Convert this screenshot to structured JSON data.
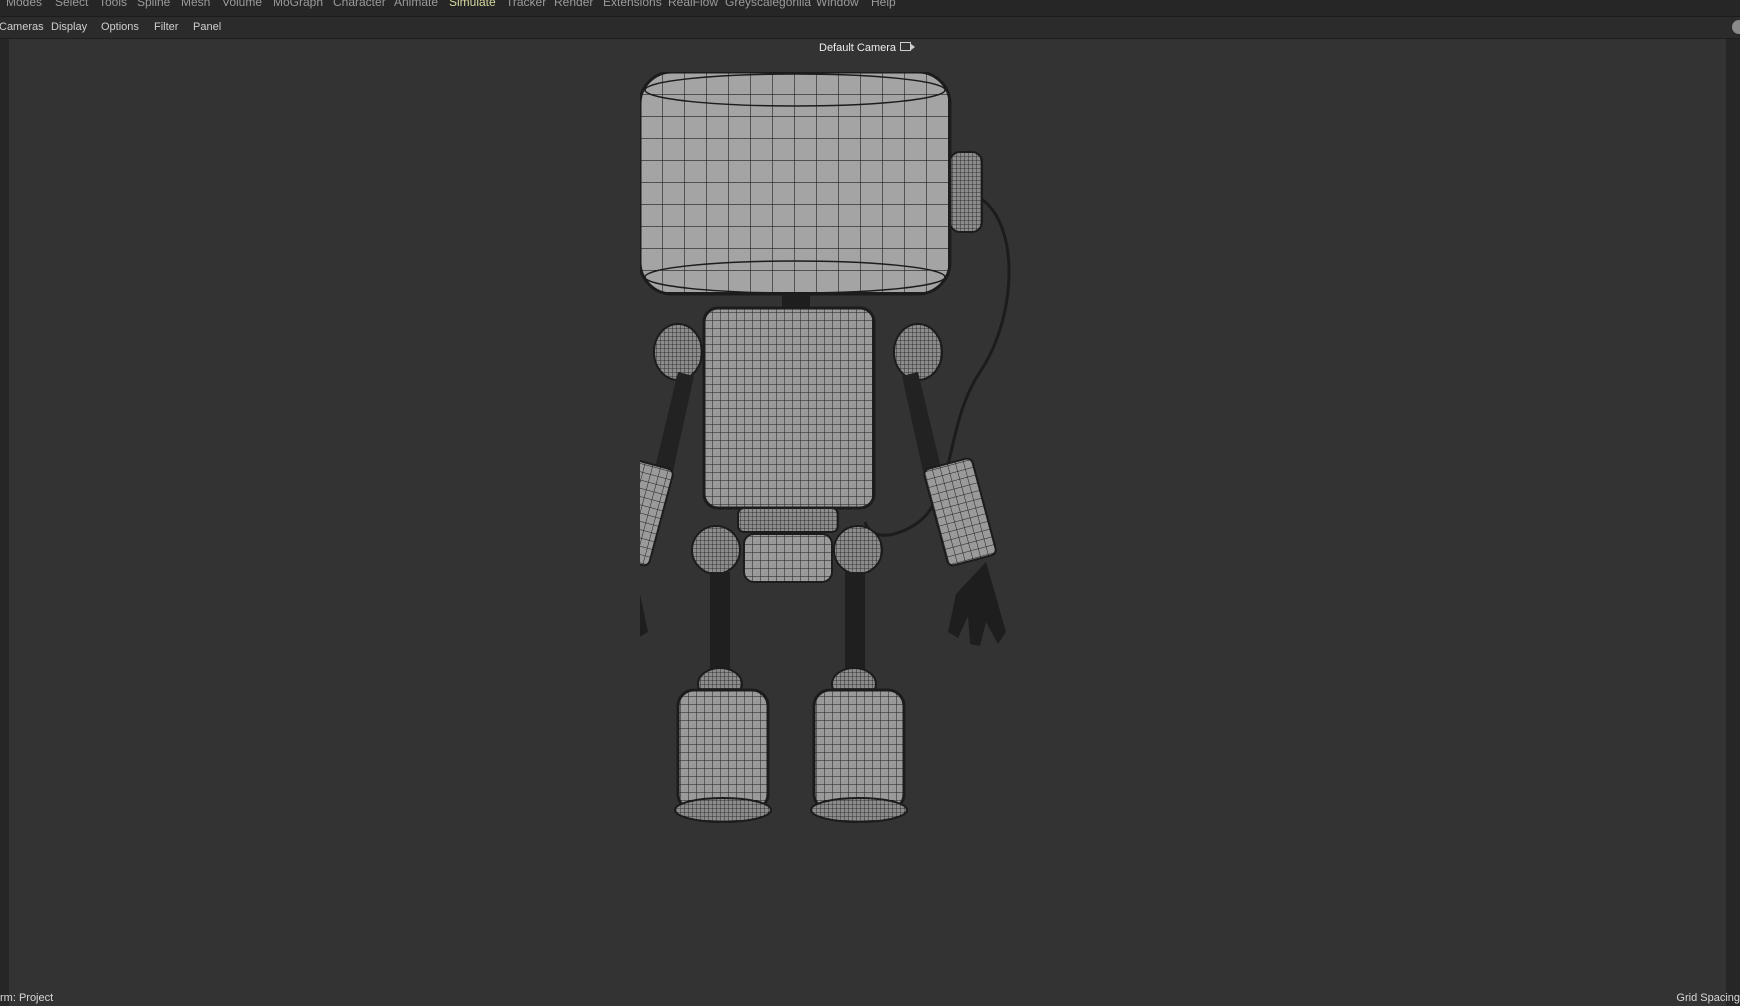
{
  "menubar": {
    "items": [
      "Modes",
      "Select",
      "Tools",
      "Spline",
      "Mesh",
      "Volume",
      "MoGraph",
      "Character",
      "Animate",
      "Simulate",
      "Tracker",
      "Render",
      "Extensions",
      "RealFlow",
      "Greyscalegorilla",
      "Window",
      "Help"
    ],
    "active_item": "Simulate"
  },
  "viewport_menu": {
    "items": [
      "Cameras",
      "Display",
      "Options",
      "Filter",
      "Panel"
    ]
  },
  "viewport": {
    "camera_label": "Default Camera",
    "camera_icon": "camera-switch-icon",
    "model": "robot-wireframe"
  },
  "status": {
    "left": "rm: Project",
    "right": "Grid Spacing"
  },
  "colors": {
    "viewport_bg": "#333333",
    "menu_bg": "#262626",
    "active_menu": "#d8d8a0",
    "mesh_fill": "#9e9e9e",
    "wire": "#1f1f1f"
  }
}
